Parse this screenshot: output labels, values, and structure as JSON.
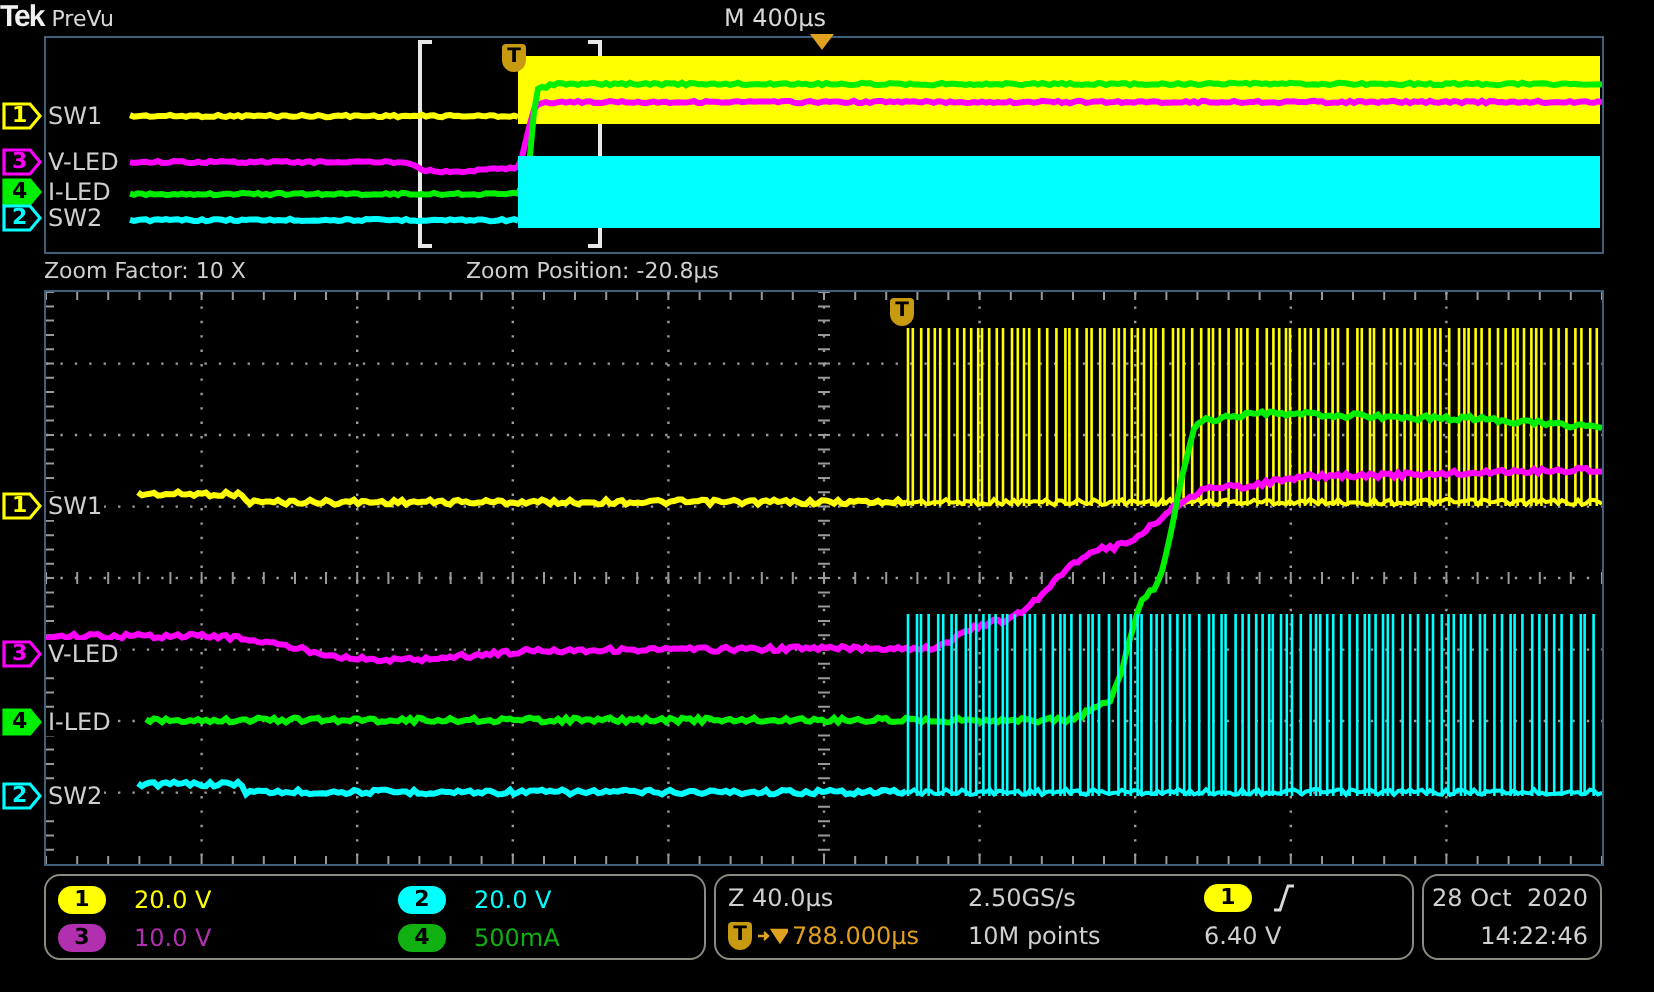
{
  "header": {
    "logo": "Tek",
    "mode": "PreVu",
    "timebase": "M 400μs"
  },
  "overview": {
    "trigger_marker": "T",
    "traces": [
      {
        "number": "1",
        "label": "SW1",
        "color": "#ffff00",
        "selected": false,
        "kind": "switch"
      },
      {
        "number": "3",
        "label": "V-LED",
        "color": "#ff00ff",
        "selected": false,
        "kind": "voltage"
      },
      {
        "number": "4",
        "label": "I-LED",
        "color": "#00ee00",
        "selected": true,
        "kind": "current"
      },
      {
        "number": "2",
        "label": "SW2",
        "color": "#00ffff",
        "selected": false,
        "kind": "switch"
      }
    ]
  },
  "zoom_info": {
    "factor": "Zoom Factor: 10 X",
    "position": "Zoom Position: -20.8μs"
  },
  "zoom": {
    "trigger_marker": "T",
    "traces": [
      {
        "number": "1",
        "label": "SW1",
        "color": "#ffff00",
        "selected": false,
        "kind": "switch"
      },
      {
        "number": "3",
        "label": "V-LED",
        "color": "#ff00ff",
        "selected": false,
        "kind": "voltage"
      },
      {
        "number": "4",
        "label": "I-LED",
        "color": "#00ee00",
        "selected": true,
        "kind": "current"
      },
      {
        "number": "2",
        "label": "SW2",
        "color": "#00ffff",
        "selected": false,
        "kind": "switch"
      }
    ]
  },
  "channel_readouts": [
    {
      "number": "1",
      "scale": "20.0 V",
      "color": "#ffff00"
    },
    {
      "number": "2",
      "scale": "20.0 V",
      "color": "#00ffff"
    },
    {
      "number": "3",
      "scale": "10.0 V",
      "color": "#b030b0"
    },
    {
      "number": "4",
      "scale": "500mA",
      "color": "#10b010"
    }
  ],
  "acquisition": {
    "zoom_scale": "Z 40.0μs",
    "trigger_marker": "T",
    "trigger_position": "788.000μs",
    "sample_rate": "2.50GS/s",
    "record_length": "10M points"
  },
  "trigger": {
    "source": "1",
    "threshold": "6.40 V"
  },
  "clock": {
    "date": "28 Oct  2020",
    "time": "14:22:46"
  }
}
